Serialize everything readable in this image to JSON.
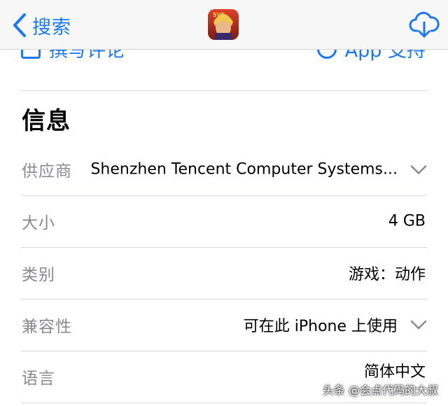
{
  "navbar": {
    "back_label": "搜索",
    "app_icon_badge": "5V5"
  },
  "hidden_row": {
    "left_text": "撰写评论",
    "right_text": "App 支持"
  },
  "section": {
    "title": "信息"
  },
  "rows": [
    {
      "label": "供应商",
      "value": "Shenzhen Tencent Computer Systems...",
      "expandable": true
    },
    {
      "label": "大小",
      "value": "4 GB",
      "expandable": false
    },
    {
      "label": "类别",
      "value": "游戏：动作",
      "expandable": false
    },
    {
      "label": "兼容性",
      "value": "可在此 iPhone 上使用",
      "expandable": true
    },
    {
      "label": "语言",
      "value": "简体中文",
      "expandable": false
    }
  ],
  "watermark": "头条 @会点代码的大叔",
  "colors": {
    "accent": "#1a78f2",
    "label_gray": "#8a8a8e",
    "divider": "#d8d8dc"
  }
}
